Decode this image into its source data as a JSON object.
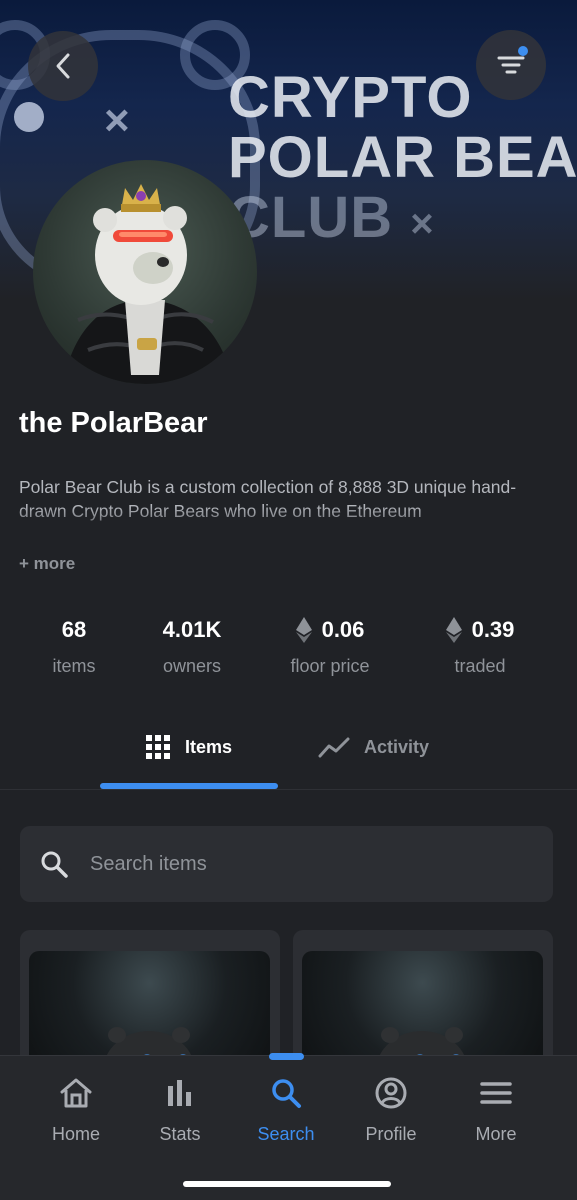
{
  "banner": {
    "line1": "CRYPTO",
    "line2": "POLAR BEA",
    "line3": "CLUB",
    "mark": "×"
  },
  "header": {
    "back_icon": "chevron-left-icon",
    "filter_icon": "filter-icon",
    "filter_badge_color": "#3d8ef0"
  },
  "collection": {
    "name": "the PolarBear",
    "description": "Polar Bear Club is a custom collection of 8,888 3D unique hand-drawn Crypto Polar Bears who live on the Ethereum",
    "more_label": "+ more"
  },
  "stats": [
    {
      "value": "68",
      "label": "items",
      "icon": ""
    },
    {
      "value": "4.01K",
      "label": "owners",
      "icon": ""
    },
    {
      "value": "0.06",
      "label": "floor price",
      "icon": "ethereum-icon"
    },
    {
      "value": "0.39",
      "label": "traded",
      "icon": "ethereum-icon"
    }
  ],
  "tabs": [
    {
      "label": "Items",
      "icon": "grid-icon",
      "active": true
    },
    {
      "label": "Activity",
      "icon": "trend-line-icon",
      "active": false
    }
  ],
  "search": {
    "placeholder": "Search items",
    "value": ""
  },
  "bottom_nav": [
    {
      "label": "Home",
      "icon": "home-icon"
    },
    {
      "label": "Stats",
      "icon": "bar-chart-icon"
    },
    {
      "label": "Search",
      "icon": "search-icon",
      "active": true
    },
    {
      "label": "Profile",
      "icon": "user-circle-icon"
    },
    {
      "label": "More",
      "icon": "menu-icon"
    }
  ],
  "colors": {
    "accent": "#3d8ef0",
    "background": "#202226",
    "muted_text": "#8f9399"
  }
}
